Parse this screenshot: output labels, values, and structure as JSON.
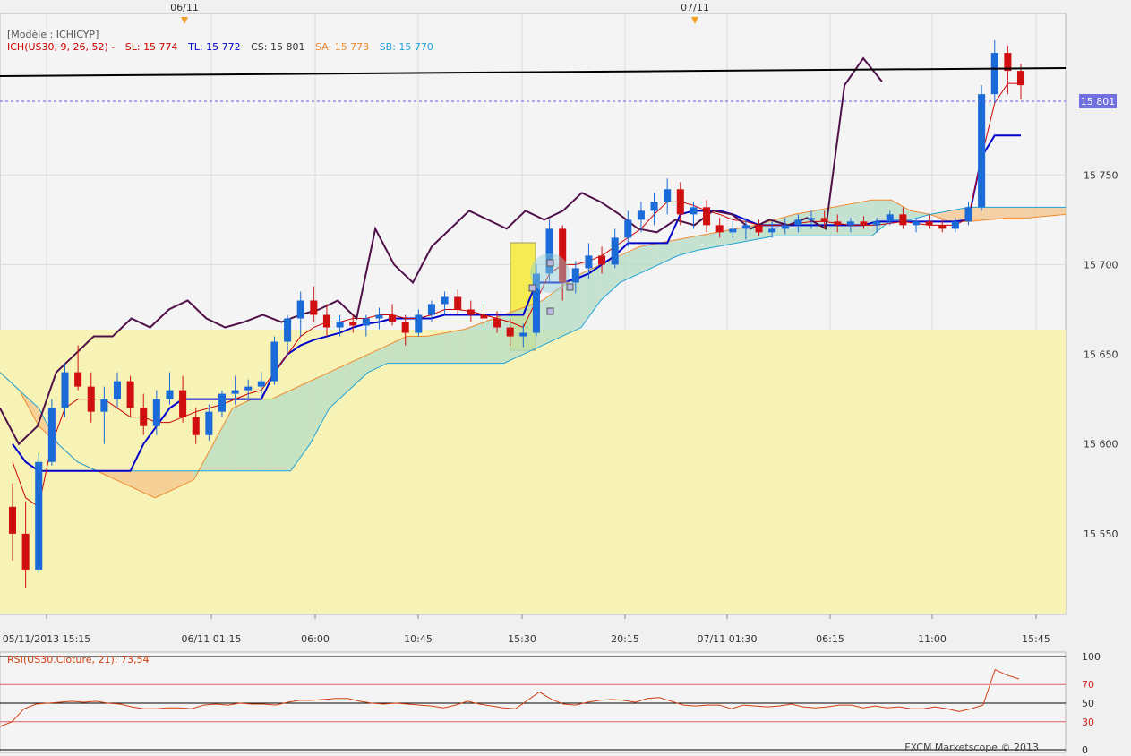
{
  "top_markers": [
    "06/11",
    "07/11"
  ],
  "legend": {
    "model": "[Modèle : ICHICYP]",
    "prefix": "ICH(US30, 9, 26, 52) -",
    "items": [
      {
        "text": "SL: 15 774",
        "color": "#d00000"
      },
      {
        "text": "TL: 15 772",
        "color": "#0000cc"
      },
      {
        "text": "CS: 15 801",
        "color": "#333333"
      },
      {
        "text": "SA: 15 773",
        "color": "#f08a30"
      },
      {
        "text": "SB: 15 770",
        "color": "#1fa3d8"
      }
    ]
  },
  "price_badge": "15 801",
  "rsi": {
    "label": "RSI(US30.Cloture, 21): 73,54",
    "levels": [
      "100",
      "70",
      "50",
      "30",
      "0"
    ],
    "series": [
      25,
      30,
      44,
      49,
      50,
      51,
      52,
      51,
      52,
      50,
      49,
      46,
      44,
      44,
      45,
      45,
      44,
      48,
      49,
      48,
      50,
      49,
      49,
      48,
      51,
      53,
      53,
      54,
      55,
      55,
      52,
      50,
      49,
      50,
      49,
      48,
      47,
      45,
      48,
      52,
      49,
      47,
      45,
      44,
      53,
      62,
      54,
      49,
      48,
      51,
      53,
      54,
      53,
      51,
      55,
      56,
      52,
      48,
      47,
      48,
      48,
      44,
      48,
      47,
      46,
      47,
      49,
      46,
      45,
      46,
      48,
      48,
      45,
      47,
      45,
      46,
      44,
      44,
      46,
      44,
      41,
      44,
      48,
      86,
      80,
      76
    ]
  },
  "footer": "FXCM Marketscope © 2013",
  "chart_data": {
    "type": "candlestick",
    "symbol": "US30",
    "x_ticks": [
      "05/11/2013 15:15",
      "06/11 01:15",
      "06:00",
      "10:45",
      "15:30",
      "20:15",
      "07/11 01:30",
      "06:15",
      "11:00",
      "15:45"
    ],
    "y_ticks": [
      15550,
      15600,
      15650,
      15700,
      15750
    ],
    "ylim": [
      15505,
      15840
    ],
    "current_price": 15801,
    "candles": [
      [
        15565,
        15578,
        15535,
        15550
      ],
      [
        15550,
        15568,
        15520,
        15530
      ],
      [
        15530,
        15595,
        15528,
        15590
      ],
      [
        15590,
        15625,
        15588,
        15620
      ],
      [
        15620,
        15645,
        15615,
        15640
      ],
      [
        15640,
        15655,
        15630,
        15632
      ],
      [
        15632,
        15640,
        15612,
        15618
      ],
      [
        15618,
        15632,
        15600,
        15625
      ],
      [
        15625,
        15640,
        15620,
        15635
      ],
      [
        15635,
        15638,
        15615,
        15620
      ],
      [
        15620,
        15628,
        15605,
        15610
      ],
      [
        15610,
        15630,
        15605,
        15625
      ],
      [
        15625,
        15640,
        15622,
        15630
      ],
      [
        15630,
        15638,
        15612,
        15615
      ],
      [
        15615,
        15620,
        15600,
        15605
      ],
      [
        15605,
        15622,
        15602,
        15618
      ],
      [
        15618,
        15630,
        15615,
        15628
      ],
      [
        15628,
        15638,
        15622,
        15630
      ],
      [
        15630,
        15636,
        15624,
        15632
      ],
      [
        15632,
        15640,
        15626,
        15635
      ],
      [
        15635,
        15660,
        15633,
        15657
      ],
      [
        15657,
        15672,
        15650,
        15670
      ],
      [
        15670,
        15685,
        15660,
        15680
      ],
      [
        15680,
        15688,
        15668,
        15672
      ],
      [
        15672,
        15678,
        15660,
        15665
      ],
      [
        15665,
        15672,
        15660,
        15668
      ],
      [
        15668,
        15672,
        15662,
        15666
      ],
      [
        15666,
        15672,
        15660,
        15670
      ],
      [
        15670,
        15676,
        15664,
        15672
      ],
      [
        15672,
        15678,
        15666,
        15668
      ],
      [
        15668,
        15672,
        15655,
        15662
      ],
      [
        15662,
        15675,
        15660,
        15672
      ],
      [
        15672,
        15680,
        15668,
        15678
      ],
      [
        15678,
        15685,
        15672,
        15682
      ],
      [
        15682,
        15686,
        15672,
        15675
      ],
      [
        15675,
        15680,
        15668,
        15672
      ],
      [
        15672,
        15678,
        15665,
        15670
      ],
      [
        15670,
        15674,
        15662,
        15665
      ],
      [
        15665,
        15670,
        15655,
        15660
      ],
      [
        15660,
        15667,
        15654,
        15662
      ],
      [
        15662,
        15700,
        15660,
        15695
      ],
      [
        15695,
        15725,
        15690,
        15720
      ],
      [
        15720,
        15722,
        15680,
        15690
      ],
      [
        15690,
        15702,
        15684,
        15698
      ],
      [
        15698,
        15712,
        15692,
        15705
      ],
      [
        15705,
        15710,
        15695,
        15700
      ],
      [
        15700,
        15720,
        15698,
        15715
      ],
      [
        15715,
        15730,
        15710,
        15725
      ],
      [
        15725,
        15735,
        15718,
        15730
      ],
      [
        15730,
        15740,
        15722,
        15735
      ],
      [
        15735,
        15748,
        15728,
        15742
      ],
      [
        15742,
        15746,
        15722,
        15728
      ],
      [
        15728,
        15735,
        15720,
        15732
      ],
      [
        15732,
        15736,
        15718,
        15722
      ],
      [
        15722,
        15726,
        15715,
        15718
      ],
      [
        15718,
        15724,
        15715,
        15720
      ],
      [
        15720,
        15726,
        15714,
        15722
      ],
      [
        15722,
        15725,
        15716,
        15718
      ],
      [
        15718,
        15724,
        15715,
        15720
      ],
      [
        15720,
        15726,
        15717,
        15722
      ],
      [
        15722,
        15728,
        15718,
        15725
      ],
      [
        15725,
        15730,
        15720,
        15726
      ],
      [
        15726,
        15730,
        15720,
        15724
      ],
      [
        15724,
        15728,
        15718,
        15722
      ],
      [
        15722,
        15726,
        15718,
        15724
      ],
      [
        15724,
        15727,
        15720,
        15722
      ],
      [
        15722,
        15726,
        15718,
        15724
      ],
      [
        15724,
        15730,
        15722,
        15728
      ],
      [
        15728,
        15732,
        15720,
        15722
      ],
      [
        15722,
        15726,
        15718,
        15724
      ],
      [
        15724,
        15728,
        15720,
        15722
      ],
      [
        15722,
        15725,
        15718,
        15720
      ],
      [
        15720,
        15726,
        15718,
        15724
      ],
      [
        15724,
        15735,
        15722,
        15732
      ],
      [
        15732,
        15800,
        15730,
        15795
      ],
      [
        15795,
        15825,
        15790,
        15818
      ],
      [
        15818,
        15822,
        15795,
        15808
      ],
      [
        15808,
        15812,
        15792,
        15800
      ]
    ],
    "tenkan": [
      15590,
      15570,
      15565,
      15600,
      15620,
      15625,
      15625,
      15625,
      15620,
      15615,
      15615,
      15612,
      15612,
      15615,
      15618,
      15620,
      15622,
      15625,
      15628,
      15630,
      15640,
      15650,
      15660,
      15665,
      15668,
      15668,
      15670,
      15670,
      15672,
      15672,
      15670,
      15670,
      15672,
      15675,
      15675,
      15674,
      15672,
      15670,
      15668,
      15665,
      15680,
      15695,
      15700,
      15700,
      15702,
      15705,
      15710,
      15715,
      15720,
      15728,
      15735,
      15735,
      15733,
      15730,
      15728,
      15725,
      15724,
      15722,
      15722,
      15722,
      15723,
      15724,
      15724,
      15723,
      15722,
      15722,
      15722,
      15723,
      15724,
      15723,
      15722,
      15722,
      15722,
      15726,
      15760,
      15790,
      15801,
      15801
    ],
    "kijun": [
      15600,
      15590,
      15585,
      15585,
      15585,
      15585,
      15585,
      15585,
      15585,
      15585,
      15600,
      15610,
      15620,
      15625,
      15625,
      15625,
      15625,
      15625,
      15625,
      15625,
      15640,
      15650,
      15655,
      15658,
      15660,
      15662,
      15665,
      15667,
      15668,
      15670,
      15670,
      15670,
      15670,
      15672,
      15672,
      15672,
      15672,
      15672,
      15672,
      15672,
      15690,
      15690,
      15690,
      15692,
      15695,
      15700,
      15705,
      15712,
      15712,
      15712,
      15712,
      15728,
      15730,
      15730,
      15730,
      15728,
      15725,
      15722,
      15722,
      15722,
      15722,
      15722,
      15722,
      15722,
      15722,
      15722,
      15724,
      15724,
      15724,
      15724,
      15724,
      15724,
      15724,
      15725,
      15760,
      15772,
      15772,
      15772
    ],
    "chikou": [
      15620,
      15600,
      15610,
      15640,
      15650,
      15660,
      15660,
      15670,
      15665,
      15675,
      15680,
      15670,
      15665,
      15668,
      15672,
      15668,
      15672,
      15675,
      15680,
      15670,
      15720,
      15700,
      15690,
      15710,
      15720,
      15730,
      15725,
      15720,
      15730,
      15725,
      15730,
      15740,
      15735,
      15728,
      15720,
      15718,
      15725,
      15722,
      15730,
      15728,
      15720,
      15725,
      15722,
      15726,
      15720,
      15800,
      15815,
      15802
    ],
    "senkou_a": [
      15640,
      15630,
      15610,
      15600,
      15590,
      15585,
      15580,
      15575,
      15570,
      15575,
      15580,
      15600,
      15620,
      15625,
      15625,
      15630,
      15635,
      15640,
      15645,
      15650,
      15655,
      15660,
      15660,
      15662,
      15664,
      15668,
      15672,
      15676,
      15680,
      15688,
      15695,
      15700,
      15705,
      15710,
      15712,
      15714,
      15716,
      15718,
      15720,
      15722,
      15725,
      15728,
      15730,
      15732,
      15734,
      15736,
      15736,
      15730,
      15728,
      15724,
      15724,
      15725,
      15726,
      15726,
      15727,
      15728
    ],
    "senkou_b": [
      15640,
      15630,
      15620,
      15600,
      15590,
      15585,
      15585,
      15585,
      15585,
      15585,
      15585,
      15585,
      15585,
      15585,
      15585,
      15585,
      15600,
      15620,
      15630,
      15640,
      15645,
      15645,
      15645,
      15645,
      15645,
      15645,
      15645,
      15650,
      15655,
      15660,
      15665,
      15680,
      15690,
      15695,
      15700,
      15705,
      15708,
      15710,
      15712,
      15714,
      15716,
      15716,
      15716,
      15716,
      15716,
      15716,
      15725,
      15725,
      15728,
      15730,
      15732,
      15732,
      15732,
      15732,
      15732,
      15732
    ]
  }
}
